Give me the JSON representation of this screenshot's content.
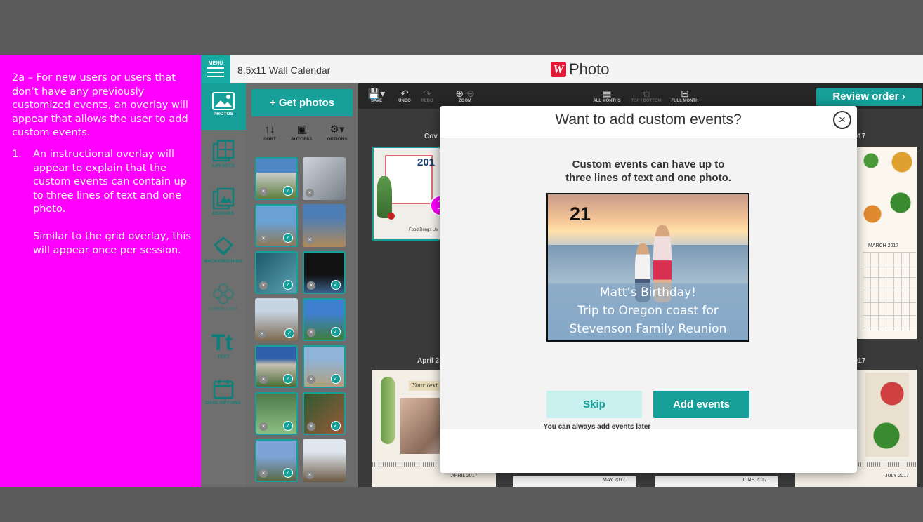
{
  "annotation": {
    "intro": "2a – For new users or users that don’t have any previously customized events, an overlay will appear that allows the user to add custom events.",
    "items": [
      {
        "number": "1.",
        "paragraphs": [
          "An instructional overlay will appear to explain that the custom events can contain up to three lines of text and one photo.",
          "Similar to the grid overlay, this will appear once per session."
        ]
      }
    ],
    "marker": "1"
  },
  "header": {
    "menu_label": "MENU",
    "project_title": "8.5x11 Wall Calendar",
    "logo_mark": "W",
    "logo_text": "Photo"
  },
  "rail": [
    {
      "label": "PHOTOS",
      "icon": "photos-icon"
    },
    {
      "label": "LAYOUTS",
      "icon": "layouts-icon"
    },
    {
      "label": "DESIGNS",
      "icon": "designs-icon"
    },
    {
      "label": "BACKGROUNDS",
      "icon": "backgrounds-icon"
    },
    {
      "label": "EMBELLISH",
      "icon": "embellish-icon"
    },
    {
      "label": "TEXT",
      "icon": "text-icon"
    },
    {
      "label": "DATE OPTIONS",
      "icon": "calendar-icon"
    }
  ],
  "photos_panel": {
    "get_photos": "+ Get photos",
    "tools": [
      {
        "label": "SORT",
        "icon": "sort-icon"
      },
      {
        "label": "AUTOFILL",
        "icon": "autofill-icon"
      },
      {
        "label": "OPTIONS",
        "icon": "gear-icon"
      }
    ]
  },
  "canvas_toolbar": {
    "save": "SAVE",
    "undo": "UNDO",
    "redo": "REDO",
    "zoom": "ZOOM",
    "all_months": "ALL MONTHS",
    "top_bottom": "TOP / BOTTOM",
    "full_month": "FULL MONTH",
    "review_order": "Review order ›"
  },
  "pages": {
    "cover": "Cov",
    "year_right": "2017",
    "april": "April 2",
    "july_top": "2017",
    "cover_year": "201",
    "cover_caption": "Food Brings Us",
    "april_sticker": "Your text",
    "march_label": "MARCH 2017",
    "bottom_labels": [
      "APRIL 2017",
      "MAY 2017",
      "JUNE 2017",
      "JULY 2017"
    ]
  },
  "modal": {
    "title": "Want to add custom events?",
    "description_line1": "Custom events can have up to",
    "description_line2": "three lines of text and one photo.",
    "example": {
      "date": "21",
      "caption_lines": [
        "Matt’s Birthday!",
        "Trip to Oregon coast for",
        "Stevenson Family Reunion"
      ]
    },
    "skip": "Skip",
    "add_events": "Add events",
    "footnote": "You can always add events later"
  },
  "colors": {
    "accent": "#16a099",
    "annotation": "#ff00ff",
    "skip_bg": "#c8f0ef",
    "brand_red": "#e31837"
  }
}
